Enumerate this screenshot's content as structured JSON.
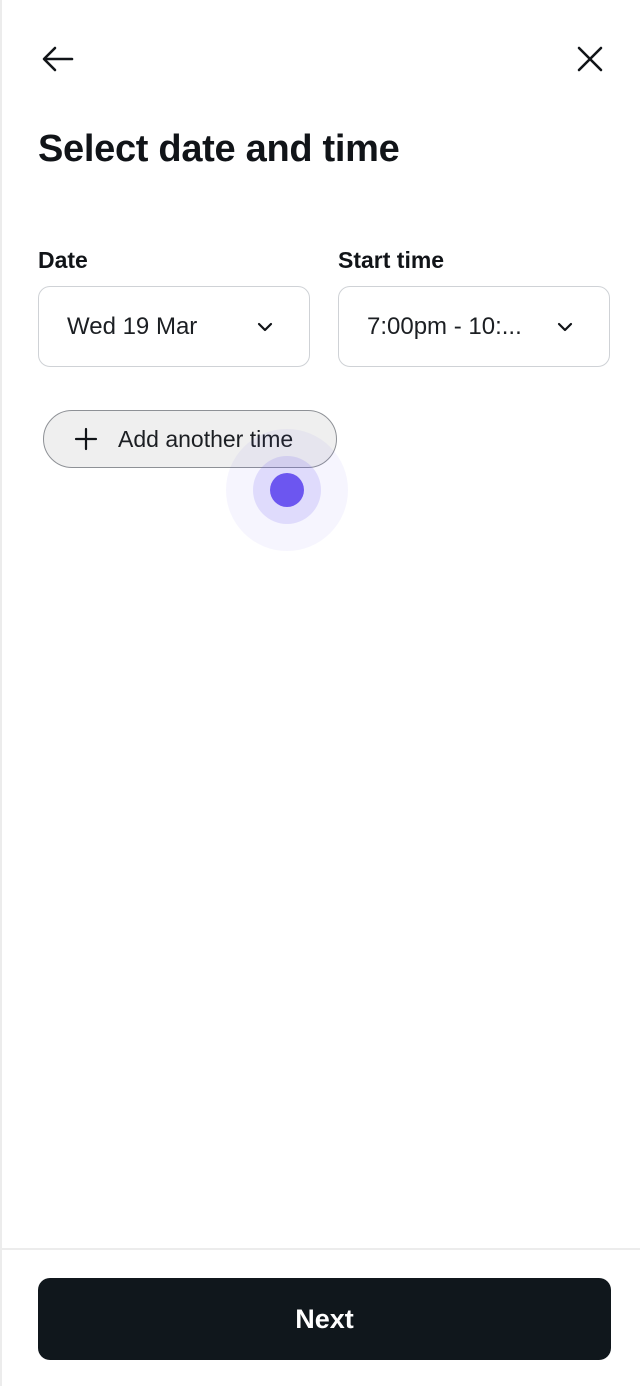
{
  "header": {
    "back_icon": "arrow-left-icon",
    "close_icon": "close-icon",
    "title": "Select date and time"
  },
  "form": {
    "date": {
      "label": "Date",
      "value": "Wed 19 Mar",
      "icon": "chevron-down-icon"
    },
    "start_time": {
      "label": "Start time",
      "value": "7:00pm - 10:...",
      "icon": "chevron-down-icon"
    },
    "add_time": {
      "label": "Add another time",
      "icon": "plus-icon"
    }
  },
  "footer": {
    "next_label": "Next"
  },
  "colors": {
    "primary": "#10171c",
    "touch_indicator": "#6c56f0",
    "border": "#cfd2d6"
  }
}
